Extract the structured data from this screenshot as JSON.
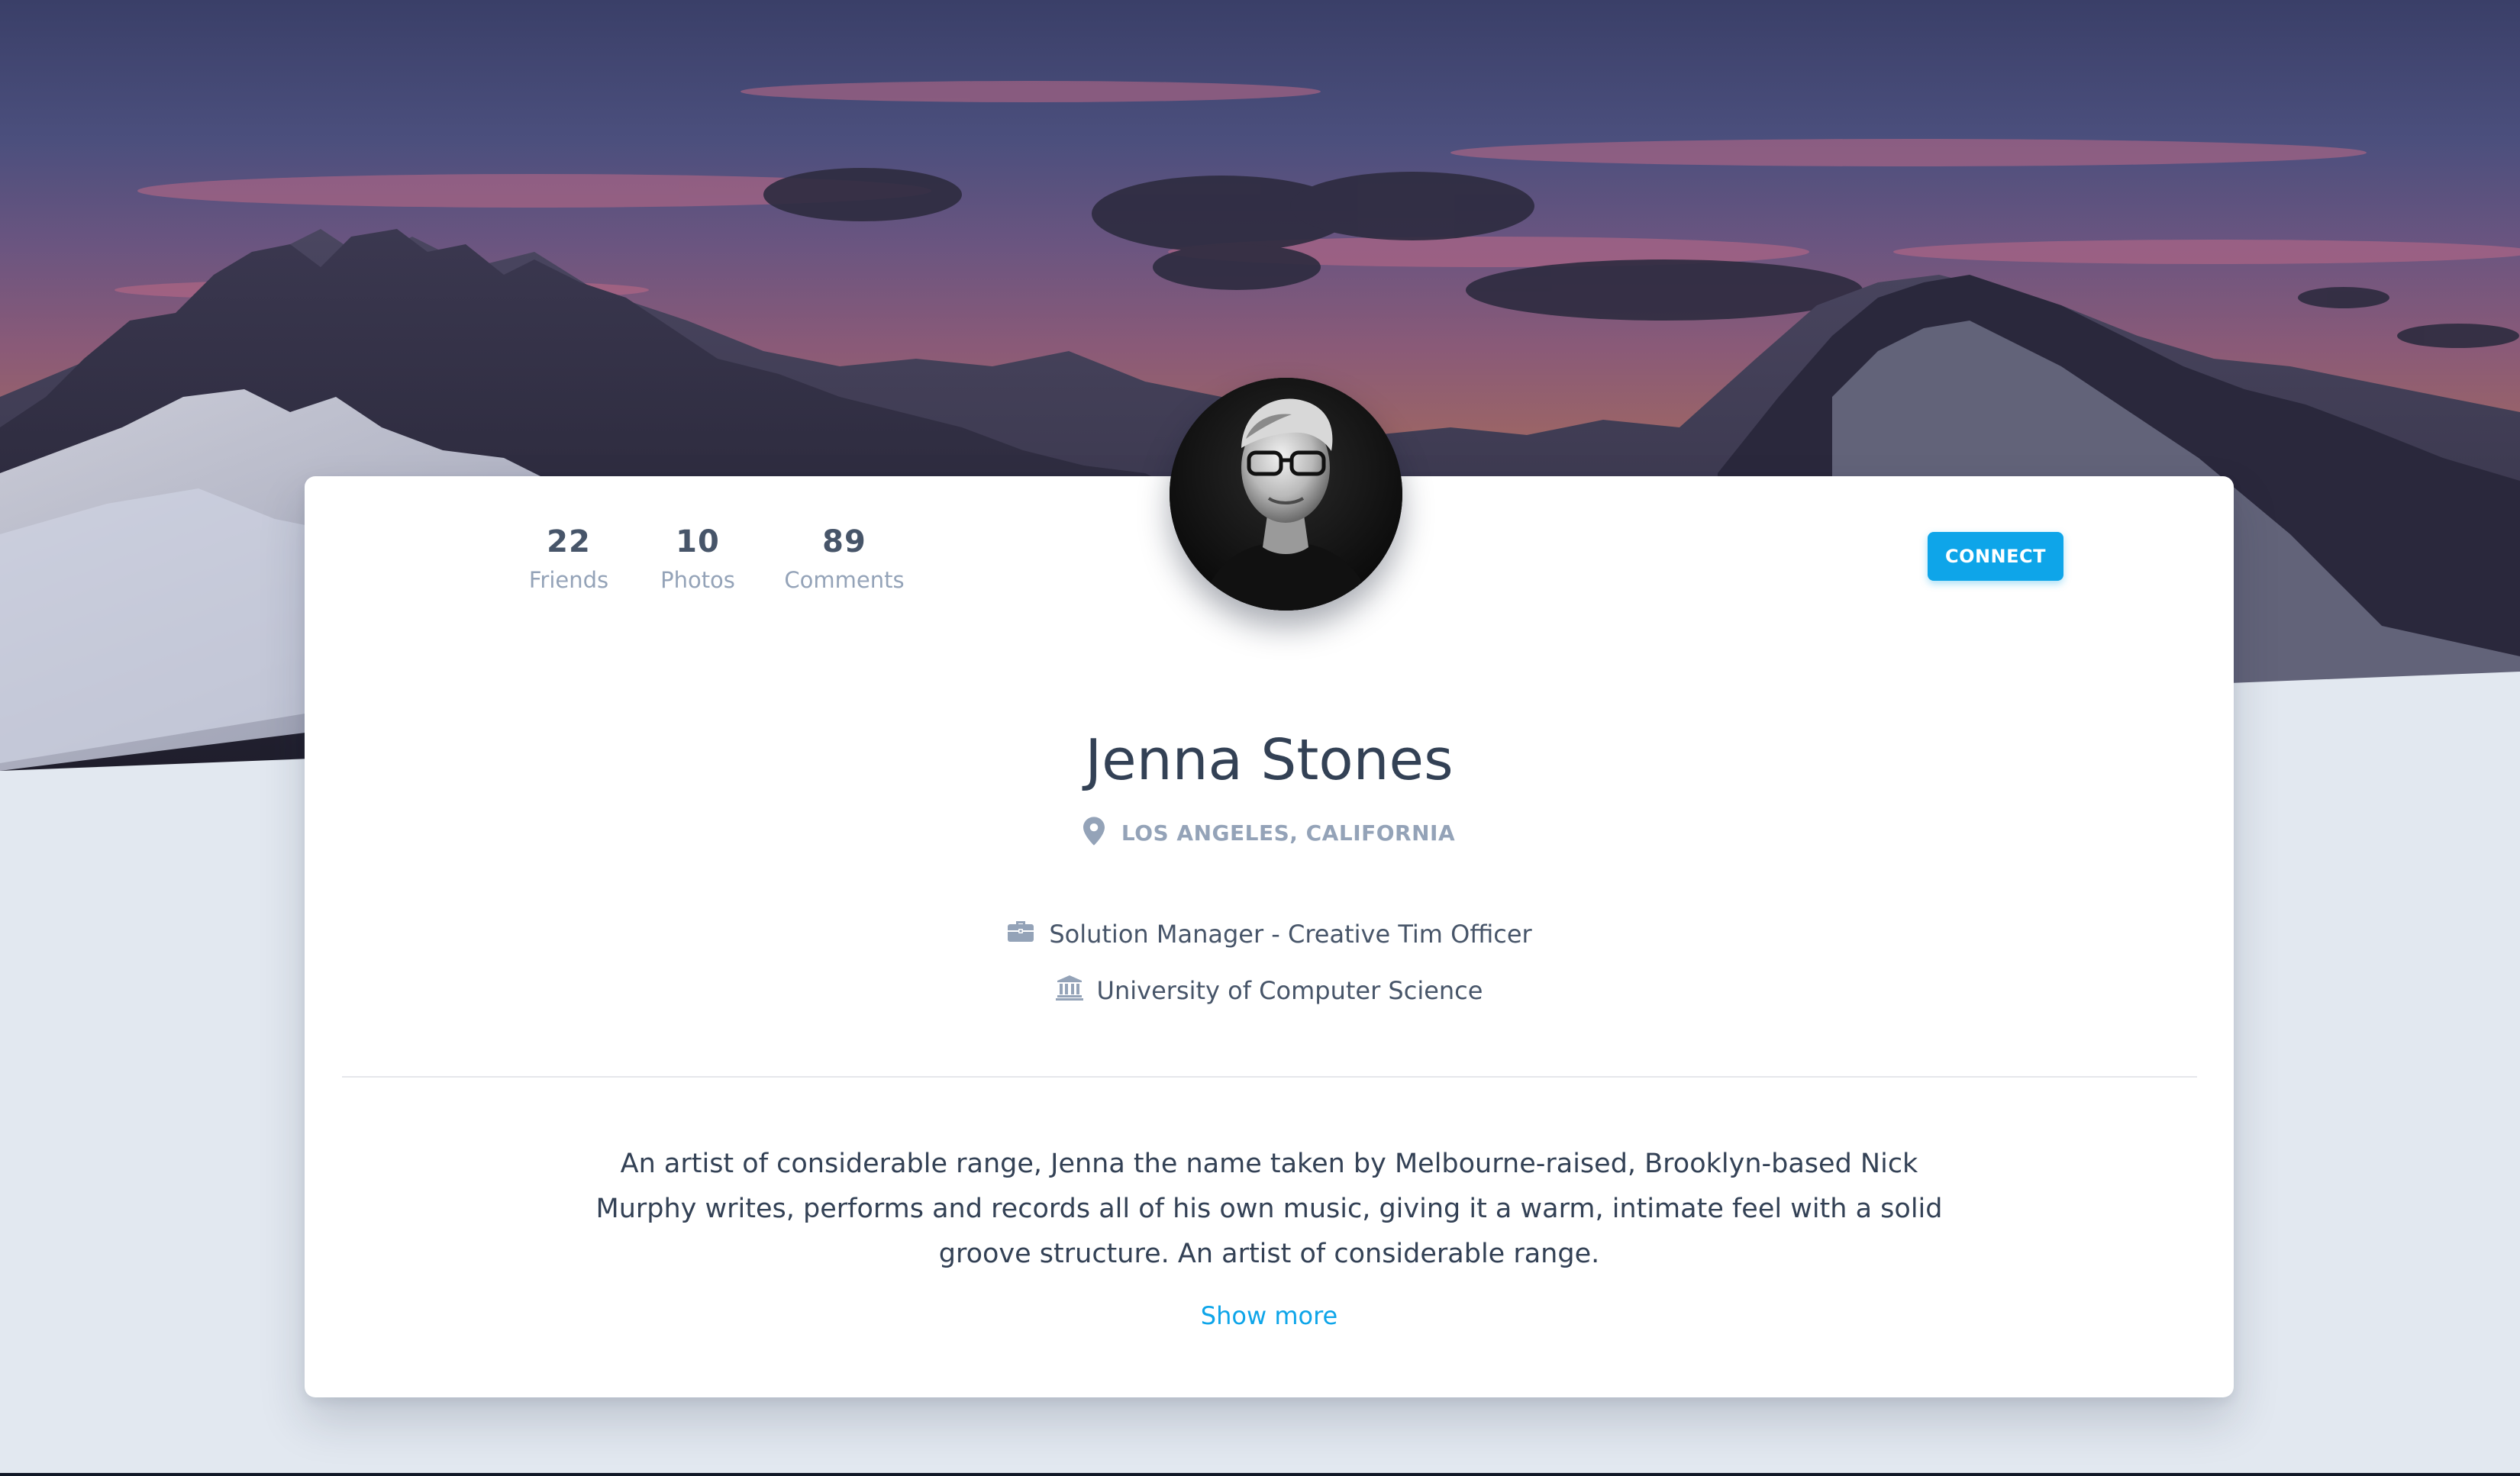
{
  "profile": {
    "name": "Jenna Stones",
    "location": "LOS ANGELES, CALIFORNIA",
    "job": "Solution Manager - Creative Tim Officer",
    "education": "University of Computer Science",
    "bio": "An artist of considerable range, Jenna the name taken by Melbourne-raised, Brooklyn-based Nick Murphy writes, performs and records all of his own music, giving it a warm, intimate feel with a solid groove structure. An artist of considerable range.",
    "show_more_label": "Show more"
  },
  "stats": [
    {
      "value": "22",
      "label": "Friends"
    },
    {
      "value": "10",
      "label": "Photos"
    },
    {
      "value": "89",
      "label": "Comments"
    }
  ],
  "actions": {
    "connect_label": "CONNECT"
  },
  "icons": {
    "location": "map-marker-icon",
    "job": "briefcase-icon",
    "education": "university-icon"
  },
  "colors": {
    "accent": "#0ea5e9",
    "page_background": "#e2e8f0",
    "heading": "#334155",
    "muted": "#94a3b8"
  }
}
